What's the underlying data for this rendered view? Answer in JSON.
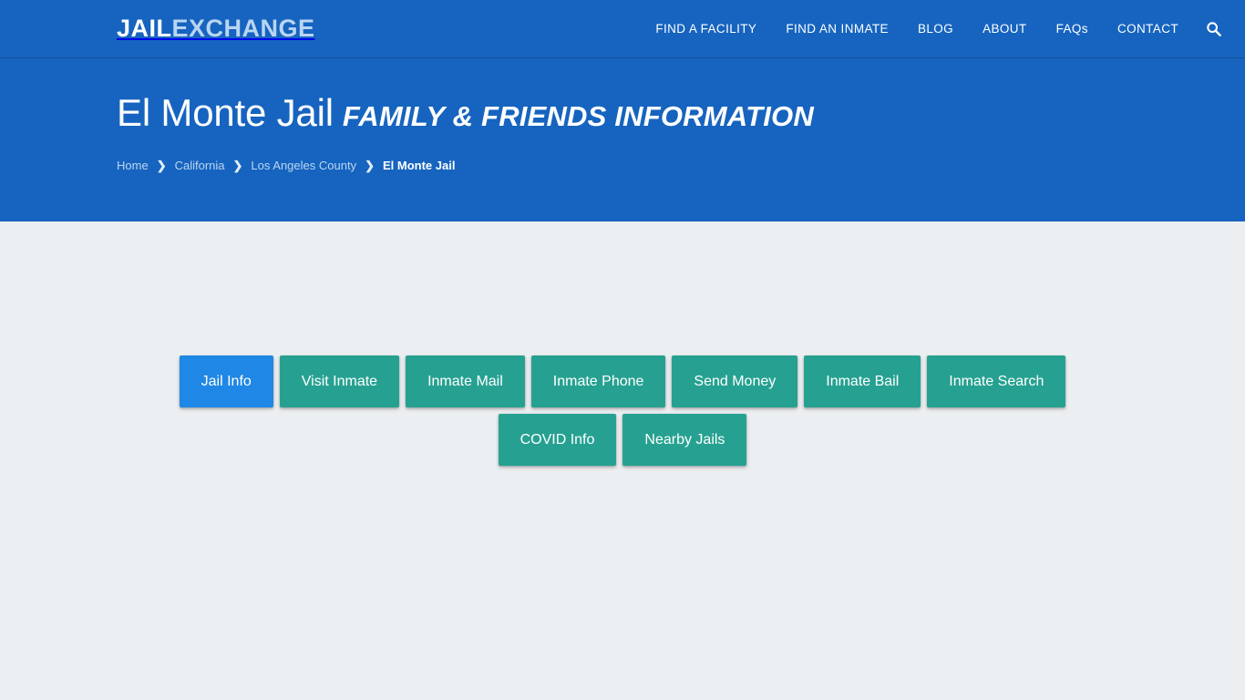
{
  "site": {
    "brand_primary": "JAIL",
    "brand_secondary": "EXCHANGE"
  },
  "colors": {
    "header_blue": "#1664bf",
    "active_tab_blue": "#1f87e5",
    "tab_teal": "#26a191",
    "page_background": "#eceff1"
  },
  "nav": {
    "items": [
      {
        "label": "FIND A FACILITY"
      },
      {
        "label": "FIND AN INMATE"
      },
      {
        "label": "BLOG"
      },
      {
        "label": "ABOUT"
      },
      {
        "label": "FAQs"
      },
      {
        "label": "CONTACT"
      }
    ],
    "search_icon": "search-icon"
  },
  "hero": {
    "title_main": "El Monte Jail",
    "title_sub": "FAMILY & FRIENDS INFORMATION",
    "breadcrumb": {
      "items": [
        {
          "label": "Home",
          "current": false
        },
        {
          "label": "California",
          "current": false
        },
        {
          "label": "Los Angeles County",
          "current": false
        },
        {
          "label": "El Monte Jail",
          "current": true
        }
      ],
      "separator": "❯"
    }
  },
  "tabs": {
    "row1": [
      {
        "label": "Jail Info",
        "active": true
      },
      {
        "label": "Visit Inmate",
        "active": false
      },
      {
        "label": "Inmate Mail",
        "active": false
      },
      {
        "label": "Inmate Phone",
        "active": false
      },
      {
        "label": "Send Money",
        "active": false
      },
      {
        "label": "Inmate Bail",
        "active": false
      },
      {
        "label": "Inmate Search",
        "active": false
      }
    ],
    "row2": [
      {
        "label": "COVID Info",
        "active": false
      },
      {
        "label": "Nearby Jails",
        "active": false
      }
    ]
  }
}
